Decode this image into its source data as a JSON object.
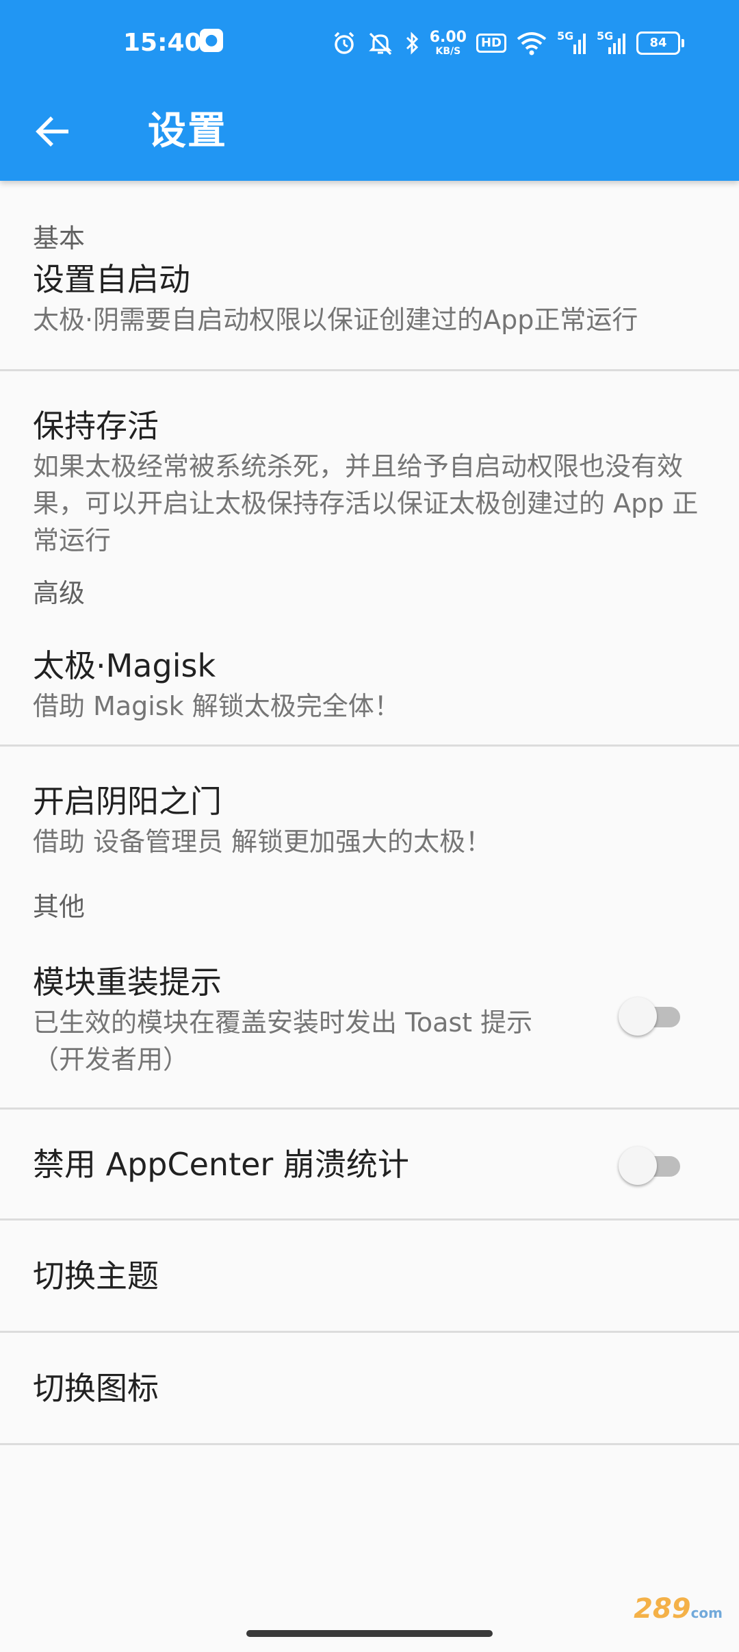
{
  "status_bar": {
    "time": "15:40",
    "net_speed_value": "6.00",
    "net_speed_unit": "KB/S",
    "hd_label": "HD",
    "sim1_label": "5G",
    "sim2_label": "5G",
    "battery_level": "84",
    "icons": [
      "baidu-icon",
      "alarm-icon",
      "mute-icon",
      "bluetooth-icon",
      "wifi-icon",
      "signal-icon",
      "battery-icon"
    ]
  },
  "toolbar": {
    "title": "设置",
    "back_icon": "arrow-left-icon"
  },
  "sections": {
    "basic": {
      "header": "基本",
      "autostart": {
        "title": "设置自启动",
        "summary": "太极·阴需要自启动权限以保证创建过的App正常运行"
      },
      "keepalive": {
        "title": "保持存活",
        "summary": "如果太极经常被系统杀死，并且给予自启动权限也没有效果，可以开启让太极保持存活以保证太极创建过的 App 正常运行"
      }
    },
    "advanced": {
      "header": "高级",
      "magisk": {
        "title": "太极·Magisk",
        "summary": "借助 Magisk 解锁太极完全体！"
      },
      "yinyang": {
        "title": "开启阴阳之门",
        "summary": "借助 设备管理员 解锁更加强大的太极！"
      }
    },
    "other": {
      "header": "其他",
      "reinstall_tip": {
        "title": "模块重装提示",
        "summary": "已生效的模块在覆盖安装时发出 Toast 提示（开发者用）",
        "enabled": false
      },
      "appcenter": {
        "title": "禁用 AppCenter 崩溃统计",
        "enabled": false
      },
      "theme": {
        "title": "切换主题"
      },
      "icon": {
        "title": "切换图标"
      }
    }
  },
  "watermark": {
    "brand": "289",
    "suffix": "com"
  },
  "colors": {
    "accent": "#2196f3",
    "switch_off_track": "#bdbdbd",
    "switch_off_thumb": "#f5f5f5"
  }
}
